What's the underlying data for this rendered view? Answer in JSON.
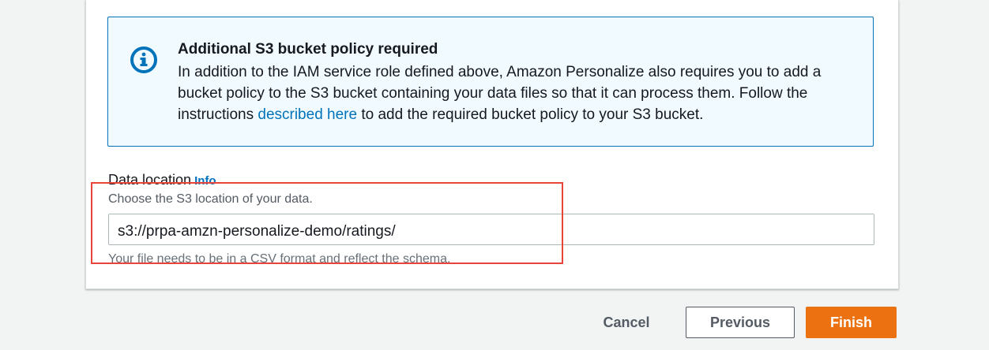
{
  "alert": {
    "icon": "info-circle-icon",
    "title": "Additional S3 bucket policy required",
    "body_before_link": "In addition to the IAM service role defined above, Amazon Personalize also requires you to add a bucket policy to the S3 bucket containing your data files so that it can process them. Follow the instructions ",
    "link_text": "described here",
    "body_after_link": " to add the required bucket policy to your S3 bucket.",
    "accent_color": "#0073bb"
  },
  "data_location": {
    "label": "Data location",
    "info_link": "Info",
    "description": "Choose the S3 location of your data.",
    "value": "s3://prpa-amzn-personalize-demo/ratings/",
    "constraint": "Your file needs to be in a CSV format and reflect the schema."
  },
  "highlight_color": "#e8443a",
  "footer": {
    "cancel_label": "Cancel",
    "previous_label": "Previous",
    "finish_label": "Finish",
    "primary_color": "#ec7211"
  }
}
